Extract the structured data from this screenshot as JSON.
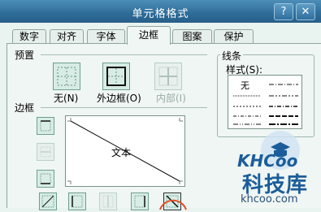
{
  "window": {
    "title": "单元格格式",
    "help_icon": "?",
    "close_icon": "✕"
  },
  "tabs": [
    "数字",
    "对齐",
    "字体",
    "边框",
    "图案",
    "保护"
  ],
  "active_tab": "边框",
  "presets": {
    "title": "预置",
    "items": [
      {
        "label": "无(N)"
      },
      {
        "label": "外边框(O)"
      },
      {
        "label": "内部(I)"
      }
    ]
  },
  "border": {
    "title": "边框",
    "preview_text": "文本"
  },
  "line": {
    "title": "线条",
    "style_label": "样式(S):",
    "none_label": "无"
  },
  "watermark": {
    "logo": "KHCoo",
    "name": "科技库",
    "url": "khcoo.com"
  },
  "colors": {
    "title_bar": "#2d6c98",
    "panel": "#eff6f3",
    "button_fill": "#d6ece4",
    "highlight_circle": "#e0502a"
  }
}
